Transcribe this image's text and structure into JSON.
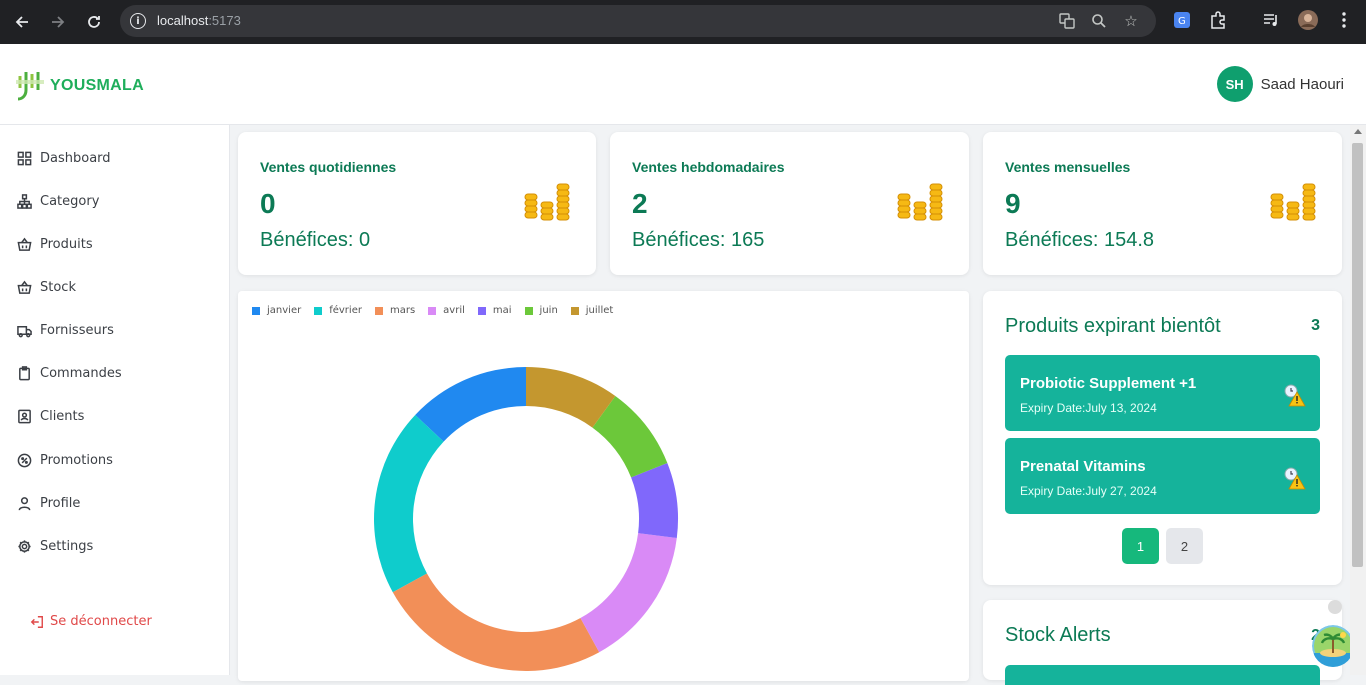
{
  "browser": {
    "url_host": "localhost",
    "url_port": ":5173"
  },
  "app": {
    "logo_text": "YOUSMALA",
    "user_initials": "SH",
    "user_name": "Saad Haouri"
  },
  "sidebar": {
    "items": [
      {
        "label": "Dashboard",
        "icon": "grid-icon"
      },
      {
        "label": "Category",
        "icon": "hierarchy-icon"
      },
      {
        "label": "Produits",
        "icon": "basket-icon"
      },
      {
        "label": "Stock",
        "icon": "basket-icon"
      },
      {
        "label": "Fornisseurs",
        "icon": "truck-icon"
      },
      {
        "label": "Commandes",
        "icon": "clipboard-icon"
      },
      {
        "label": "Clients",
        "icon": "contact-icon"
      },
      {
        "label": "Promotions",
        "icon": "badge-icon"
      },
      {
        "label": "Profile",
        "icon": "user-icon"
      },
      {
        "label": "Settings",
        "icon": "gear-icon"
      }
    ],
    "logout_label": "Se déconnecter"
  },
  "stats": [
    {
      "title": "Ventes quotidiennes",
      "value": "0",
      "profit": "Bénéfices: 0"
    },
    {
      "title": "Ventes hebdomadaires",
      "value": "2",
      "profit": "Bénéfices: 165"
    },
    {
      "title": "Ventes mensuelles",
      "value": "9",
      "profit": "Bénéfices: 154.8"
    }
  ],
  "chart_data": {
    "type": "pie",
    "categories": [
      "janvier",
      "février",
      "mars",
      "avril",
      "mai",
      "juin",
      "juillet"
    ],
    "values": [
      13,
      20,
      25,
      15,
      8,
      9,
      10
    ],
    "colors": [
      "#2089f0",
      "#0fcccc",
      "#f28f58",
      "#d98af6",
      "#8068fb",
      "#6cc83a",
      "#c4972f"
    ]
  },
  "expiring": {
    "title": "Produits expirant bientôt",
    "count": "3",
    "items": [
      {
        "name": "Probiotic Supplement +1",
        "date": "Expiry Date:July 13, 2024"
      },
      {
        "name": "Prenatal Vitamins",
        "date": "Expiry Date:July 27, 2024"
      }
    ],
    "pages": [
      "1",
      "2"
    ]
  },
  "stock_alerts": {
    "title": "Stock Alerts",
    "count": "2"
  },
  "colors": {
    "primary": "#0c7a55",
    "accent": "#15b39b",
    "logout": "#e04848"
  }
}
